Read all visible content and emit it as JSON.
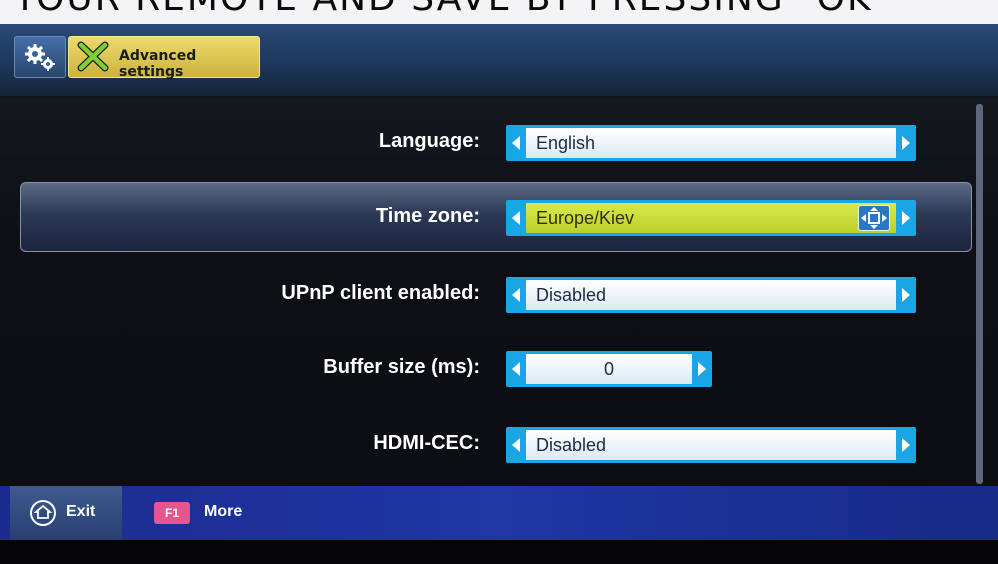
{
  "caption": {
    "text": "YOUR REMOTE AND SAVE BY PRESSING \"OK\""
  },
  "header": {
    "settings_icon": "gears-icon",
    "tab_icon": "tools-icon",
    "tab_label": "Advanced settings"
  },
  "settings": [
    {
      "label": "Language:",
      "value": "English",
      "selected": false
    },
    {
      "label": "Time zone:",
      "value": "Europe/Kiev",
      "selected": true
    },
    {
      "label": "UPnP client enabled:",
      "value": "Disabled",
      "selected": false
    },
    {
      "label": "Buffer size (ms):",
      "value": "0",
      "selected": false
    },
    {
      "label": "HDMI-CEC:",
      "value": "Disabled",
      "selected": false
    }
  ],
  "footer": {
    "exit_label": "Exit",
    "f1_key": "F1",
    "more_label": "More"
  },
  "colors": {
    "accent_blue": "#1aa5e6",
    "selected_field": "#c9dc38",
    "tab_yellow": "#e0c850",
    "footer_blue": "#1f36a5",
    "f1_pink": "#e6558f"
  }
}
